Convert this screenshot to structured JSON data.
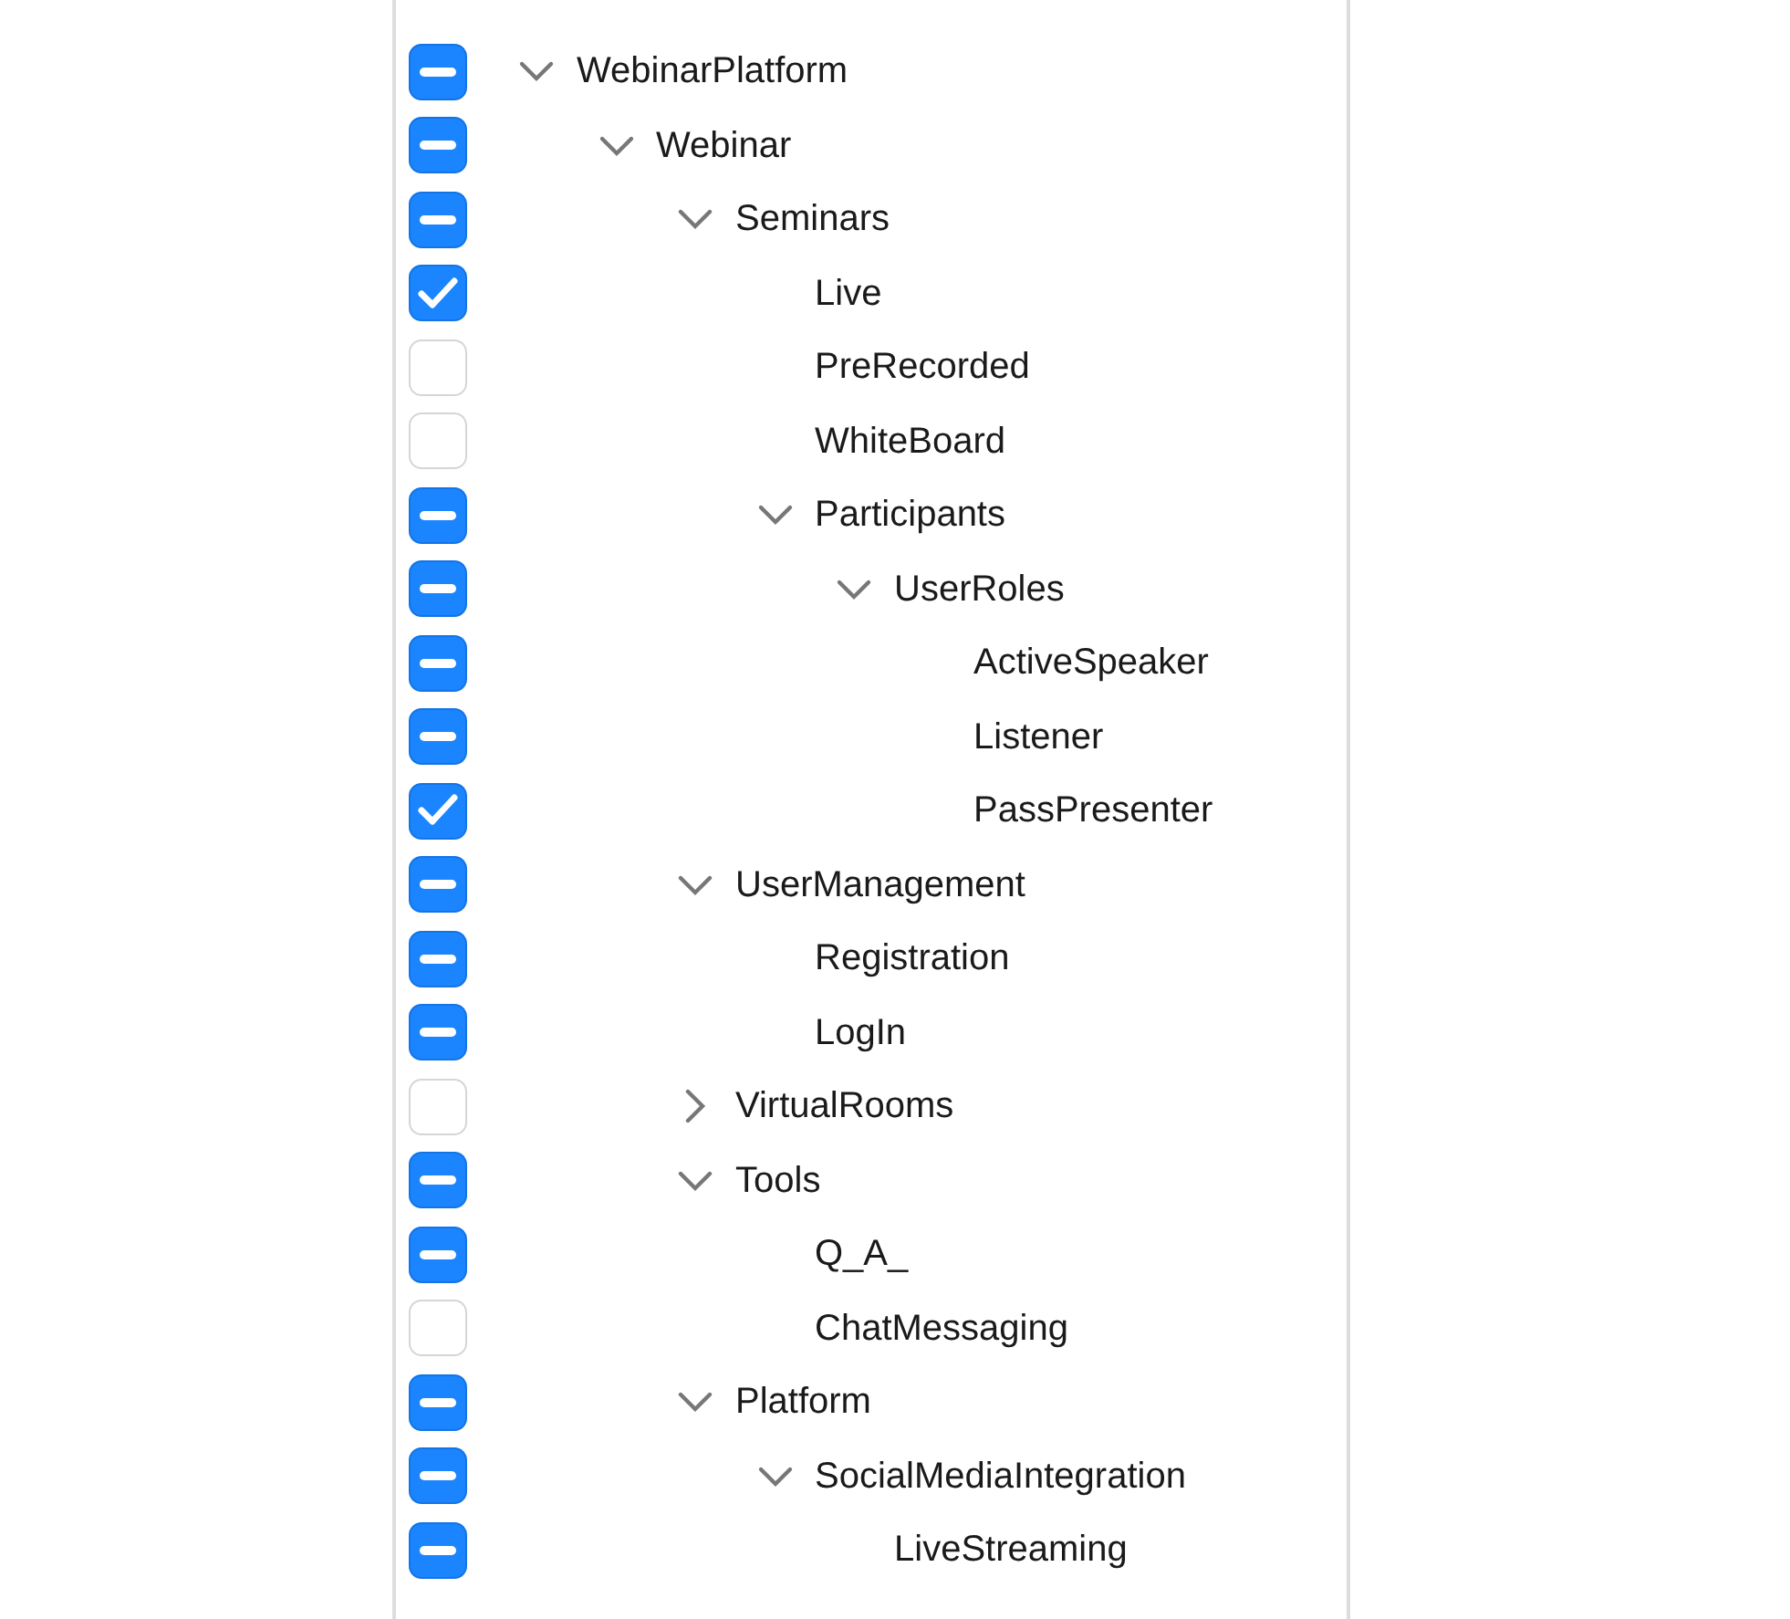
{
  "tree": [
    {
      "label": "WebinarPlatform",
      "checked": true,
      "indeterminate": true,
      "expanded": true,
      "children": [
        {
          "label": "Webinar",
          "checked": true,
          "indeterminate": true,
          "expanded": true,
          "children": [
            {
              "label": "Seminars",
              "checked": true,
              "indeterminate": true,
              "expanded": true,
              "children": [
                {
                  "label": "Live",
                  "checked": true,
                  "indeterminate": false
                },
                {
                  "label": "PreRecorded",
                  "checked": false,
                  "indeterminate": false
                },
                {
                  "label": "WhiteBoard",
                  "checked": false,
                  "indeterminate": false
                },
                {
                  "label": "Participants",
                  "checked": true,
                  "indeterminate": true,
                  "expanded": true,
                  "children": [
                    {
                      "label": "UserRoles",
                      "checked": true,
                      "indeterminate": true,
                      "expanded": true,
                      "children": [
                        {
                          "label": "ActiveSpeaker",
                          "checked": true,
                          "indeterminate": true
                        },
                        {
                          "label": "Listener",
                          "checked": true,
                          "indeterminate": true
                        },
                        {
                          "label": "PassPresenter",
                          "checked": true,
                          "indeterminate": false
                        }
                      ]
                    }
                  ]
                }
              ]
            },
            {
              "label": "UserManagement",
              "checked": true,
              "indeterminate": true,
              "expanded": true,
              "children": [
                {
                  "label": "Registration",
                  "checked": true,
                  "indeterminate": true
                },
                {
                  "label": "LogIn",
                  "checked": true,
                  "indeterminate": true
                }
              ]
            },
            {
              "label": "VirtualRooms",
              "checked": false,
              "indeterminate": false,
              "expanded": false
            },
            {
              "label": "Tools",
              "checked": true,
              "indeterminate": true,
              "expanded": true,
              "children": [
                {
                  "label": "Q_A_",
                  "checked": true,
                  "indeterminate": true
                },
                {
                  "label": "ChatMessaging",
                  "checked": false,
                  "indeterminate": false
                }
              ]
            },
            {
              "label": "Platform",
              "checked": true,
              "indeterminate": true,
              "expanded": true,
              "children": [
                {
                  "label": "SocialMediaIntegration",
                  "checked": true,
                  "indeterminate": true,
                  "expanded": true,
                  "children": [
                    {
                      "label": "LiveStreaming",
                      "checked": true,
                      "indeterminate": true
                    }
                  ]
                }
              ]
            }
          ]
        }
      ]
    }
  ]
}
